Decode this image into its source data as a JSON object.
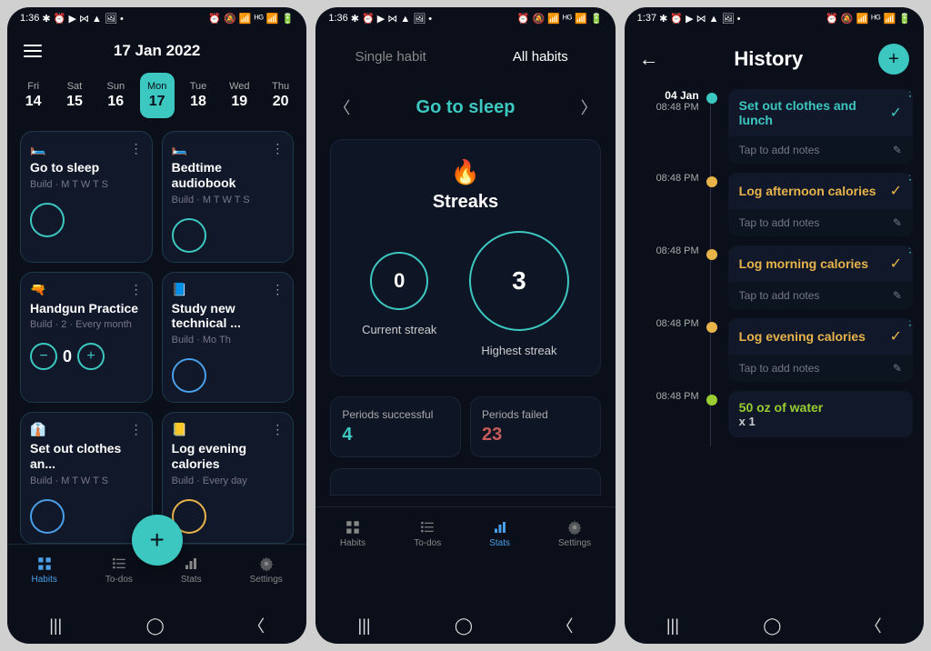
{
  "status": {
    "time1": "1:36",
    "time2": "1:36",
    "time3": "1:37"
  },
  "screen1": {
    "date_title": "17 Jan 2022",
    "days": [
      {
        "name": "Fri",
        "num": "14"
      },
      {
        "name": "Sat",
        "num": "15"
      },
      {
        "name": "Sun",
        "num": "16"
      },
      {
        "name": "Mon",
        "num": "17"
      },
      {
        "name": "Tue",
        "num": "18"
      },
      {
        "name": "Wed",
        "num": "19"
      },
      {
        "name": "Thu",
        "num": "20"
      }
    ],
    "habits": [
      {
        "emoji": "🛏️",
        "title": "Go to sleep",
        "sub": "Build · M T W T S"
      },
      {
        "emoji": "🛏️",
        "title": "Bedtime audiobook",
        "sub": "Build · M T W T S"
      },
      {
        "emoji": "🔫",
        "title": "Handgun Practice",
        "sub": "Build · 2 · Every month"
      },
      {
        "emoji": "📘",
        "title": "Study new technical ...",
        "sub": "Build · Mo Th"
      },
      {
        "emoji": "👔",
        "title": "Set out clothes an...",
        "sub": "Build · M T W T S"
      },
      {
        "emoji": "📒",
        "title": "Log evening calories",
        "sub": "Build · Every day"
      }
    ],
    "counter_val": "0",
    "tabs": {
      "habits": "Habits",
      "todos": "To-dos",
      "stats": "Stats",
      "settings": "Settings"
    }
  },
  "screen2": {
    "tab_single": "Single habit",
    "tab_all": "All habits",
    "habit_name": "Go to sleep",
    "streaks_title": "Streaks",
    "current": {
      "val": "0",
      "label": "Current streak"
    },
    "highest": {
      "val": "3",
      "label": "Highest streak"
    },
    "success": {
      "label": "Periods successful",
      "val": "4"
    },
    "failed": {
      "label": "Periods failed",
      "val": "23"
    }
  },
  "screen3": {
    "title": "History",
    "items": [
      {
        "date": "04 Jan",
        "time": "08:48 PM",
        "title": "Set out clothes and lunch",
        "color": "teal"
      },
      {
        "time": "08:48 PM",
        "title": "Log afternoon calories",
        "color": "yellow"
      },
      {
        "time": "08:48 PM",
        "title": "Log morning calories",
        "color": "yellow"
      },
      {
        "time": "08:48 PM",
        "title": "Log evening calories",
        "color": "yellow"
      },
      {
        "time": "08:48 PM",
        "title": "50 oz of water",
        "sub": "x 1",
        "color": "green"
      }
    ],
    "notes_placeholder": "Tap to add notes"
  }
}
